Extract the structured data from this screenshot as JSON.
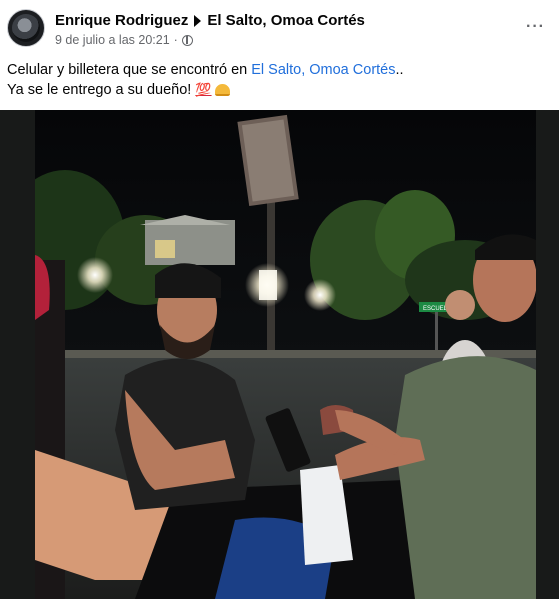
{
  "post": {
    "author": "Enrique Rodriguez",
    "location": "El Salto, Omoa Cortés",
    "timestamp": "9 de julio a las 20:21",
    "separator": "·",
    "more_options": "···",
    "text_line1_prefix": "Celular y billetera que se encontró en ",
    "text_line1_link": "El Salto, Omoa Cortés",
    "text_line1_suffix": "..",
    "text_line2": "Ya se le entrego a su dueño! ",
    "emoji_100": "💯"
  },
  "photo": {
    "sign_text": "ESCUELA"
  },
  "colors": {
    "link": "#216fdb",
    "secondary_text": "#65676b"
  }
}
